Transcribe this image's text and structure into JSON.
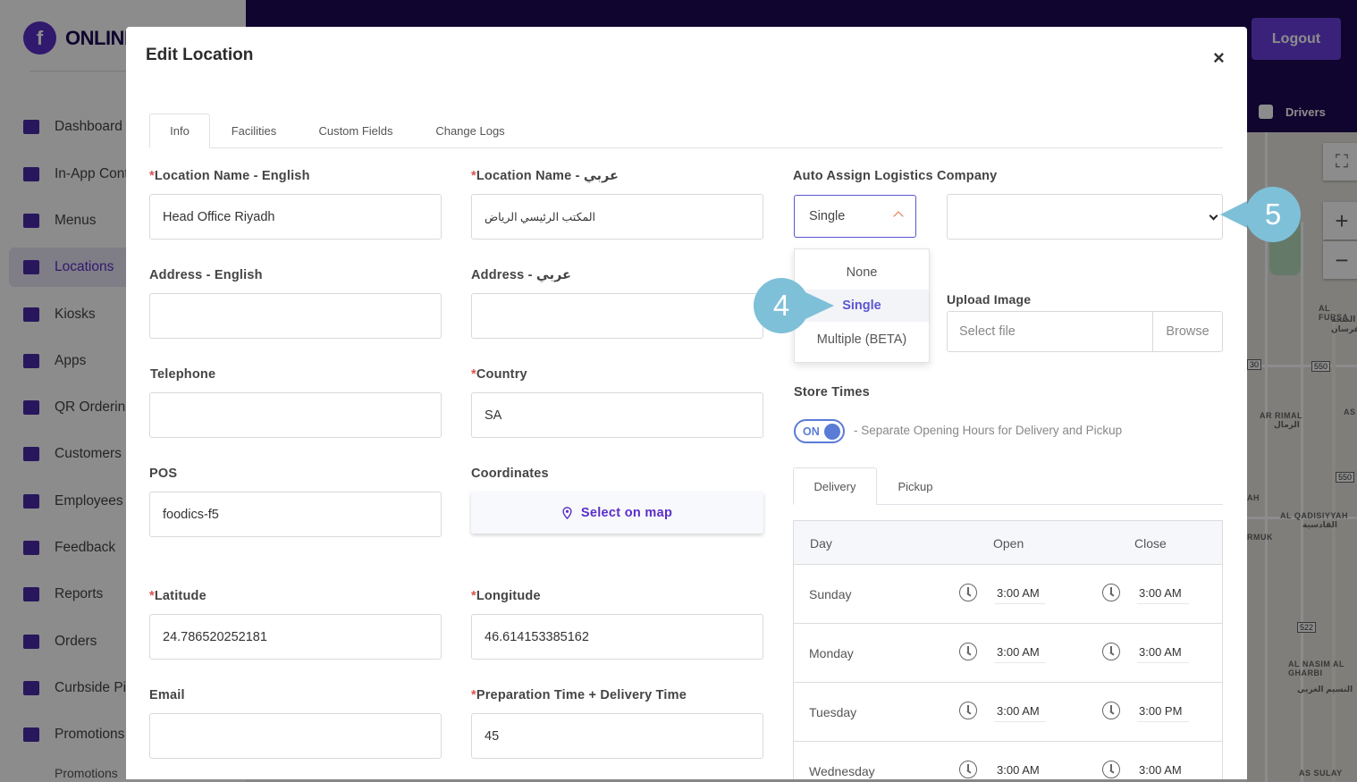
{
  "app": {
    "brand": "ONLINE",
    "logout_label": "Logout",
    "drivers_label": "Drivers"
  },
  "sidebar": {
    "items": [
      {
        "label": "Dashboard",
        "icon": "chart-icon"
      },
      {
        "label": "In-App Cont",
        "icon": "image-icon"
      },
      {
        "label": "Menus",
        "icon": "book-icon"
      },
      {
        "label": "Locations",
        "icon": "map-icon"
      },
      {
        "label": "Kiosks",
        "icon": "tablet-icon"
      },
      {
        "label": "Apps",
        "icon": "phone-icon"
      },
      {
        "label": "QR Orderin",
        "icon": "qr-icon"
      },
      {
        "label": "Customers",
        "icon": "user-icon"
      },
      {
        "label": "Employees",
        "icon": "user-icon"
      },
      {
        "label": "Feedback",
        "icon": "chat-icon"
      },
      {
        "label": "Reports",
        "icon": "flag-icon"
      },
      {
        "label": "Orders",
        "icon": "bag-icon"
      },
      {
        "label": "Curbside Pi",
        "icon": "car-icon"
      },
      {
        "label": "Promotions",
        "icon": "percent-icon"
      }
    ],
    "sub_item": "Promotions"
  },
  "map": {
    "labels": [
      "AL FURSA",
      "الصحة الفرسان",
      "AR RIMAL",
      "الرمال",
      "AL QADISIYYAH",
      "القادسية",
      "RMUK",
      "AL NASIM AL GHARBI",
      "النسيم الغربي",
      "AS SULAY",
      "AH",
      "AS"
    ],
    "shields": [
      "550",
      "550",
      "522",
      "30"
    ]
  },
  "modal": {
    "title": "Edit Location",
    "close": "×",
    "tabs": [
      "Info",
      "Facilities",
      "Custom Fields",
      "Change Logs"
    ],
    "fields": {
      "name_en": {
        "label": "Location Name - English",
        "value": "Head Office Riyadh"
      },
      "name_ar": {
        "label": "Location Name - عربي",
        "value": "المكتب الرئيسي الرياض"
      },
      "addr_en": {
        "label": "Address - English",
        "value": ""
      },
      "addr_ar": {
        "label": "Address - عربي",
        "value": ""
      },
      "phone": {
        "label": "Telephone",
        "value": ""
      },
      "country": {
        "label": "Country",
        "value": "SA"
      },
      "pos": {
        "label": "POS",
        "value": "foodics-f5"
      },
      "coords": {
        "label": "Coordinates",
        "button": "Select on map"
      },
      "lat": {
        "label": "Latitude",
        "value": "24.786520252181"
      },
      "lng": {
        "label": "Longitude",
        "value": "46.614153385162"
      },
      "email": {
        "label": "Email",
        "value": ""
      },
      "prep": {
        "label": "Preparation Time + Delivery Time",
        "value": "45"
      }
    },
    "auto_assign": {
      "label": "Auto Assign Logistics Company",
      "selected": "Single",
      "options": [
        "None",
        "Single",
        "Multiple (BETA)"
      ]
    },
    "upload": {
      "label": "Upload Image",
      "placeholder": "Select file",
      "browse": "Browse"
    },
    "store_times": {
      "label": "Store Times",
      "toggle": "ON",
      "toggle_desc": "- Separate Opening Hours for Delivery and Pickup",
      "tabs": [
        "Delivery",
        "Pickup"
      ],
      "columns": [
        "Day",
        "Open",
        "Close"
      ],
      "rows": [
        {
          "day": "Sunday",
          "open": "3:00 AM",
          "close": "3:00 AM"
        },
        {
          "day": "Monday",
          "open": "3:00 AM",
          "close": "3:00 AM"
        },
        {
          "day": "Tuesday",
          "open": "3:00 AM",
          "close": "3:00 PM"
        },
        {
          "day": "Wednesday",
          "open": "3:00 AM",
          "close": "3:00 AM"
        }
      ]
    }
  },
  "callouts": {
    "step4": "4",
    "step5": "5"
  },
  "colors": {
    "accent": "#5a2ec8",
    "topbar": "#1e0a55",
    "callout": "#7ec0d8"
  }
}
